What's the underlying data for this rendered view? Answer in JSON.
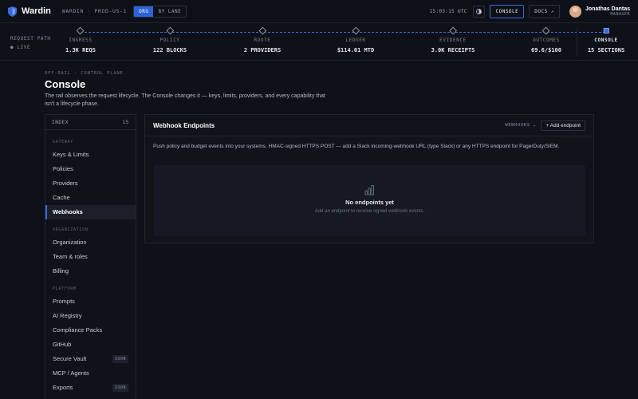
{
  "app": {
    "brand": "Wardin",
    "env": "WARDIN · PROD-US-1",
    "scope_options": [
      "ORG",
      "BY LANE"
    ],
    "scope_active": "ORG",
    "clock": "15:03:15 UTC",
    "console_label": "CONSOLE",
    "docs_label": "DOCS ↗",
    "user": {
      "name": "Jonathas Dantas",
      "role": "MANAGER"
    },
    "accent": "#3b6ae0"
  },
  "pipeline": {
    "label": "REQUEST PATH",
    "live": "● LIVE",
    "stages": [
      {
        "name": "INGRESS",
        "value": "1.3K REQS"
      },
      {
        "name": "POLICY",
        "value": "122 BLOCKS"
      },
      {
        "name": "ROUTE",
        "value": "2 PROVIDERS"
      },
      {
        "name": "LEDGER",
        "value": "$114.01 MTD"
      },
      {
        "name": "EVIDENCE",
        "value": "3.0K RECEIPTS"
      },
      {
        "name": "OUTCOMES",
        "value": "69.6/$100"
      }
    ],
    "console_stage": {
      "name": "CONSOLE",
      "value": "15 SECTIONS"
    }
  },
  "heading": {
    "crumb": "OFF-RAIL · CONTROL PLANE",
    "title": "Console",
    "description": "The rail observes the request lifecycle. The Console changes it — keys, limits, providers, and every capability that isn't a lifecycle phase."
  },
  "index": {
    "label": "INDEX",
    "count": "15",
    "groups": [
      {
        "name": "GATEWAY",
        "items": [
          {
            "label": "Keys & Limits"
          },
          {
            "label": "Policies"
          },
          {
            "label": "Providers"
          },
          {
            "label": "Cache"
          },
          {
            "label": "Webhooks",
            "active": true
          }
        ]
      },
      {
        "name": "ORGANIZATION",
        "items": [
          {
            "label": "Organization"
          },
          {
            "label": "Team & roles"
          },
          {
            "label": "Billing"
          }
        ]
      },
      {
        "name": "PLATFORM",
        "items": [
          {
            "label": "Prompts"
          },
          {
            "label": "AI Registry"
          },
          {
            "label": "Compliance Packs"
          },
          {
            "label": "GitHub"
          },
          {
            "label": "Secure Vault",
            "badge": "SOON"
          },
          {
            "label": "MCP / Agents"
          },
          {
            "label": "Exports",
            "badge": "SOON"
          }
        ]
      }
    ]
  },
  "webhooks": {
    "title": "Webhook Endpoints",
    "filter": "WEBHOOKS ⌄",
    "add_label": "+ Add endpoint",
    "description": "Push policy and budget events into your systems. HMAC-signed HTTPS POST — add a Slack incoming-webhook URL (type Slack) or any HTTPS endpoint for PagerDuty/SIEM.",
    "empty_icon": "bar-chart-icon",
    "empty_title": "No endpoints yet",
    "empty_subtitle": "Add an endpoint to receive signed webhook events."
  }
}
